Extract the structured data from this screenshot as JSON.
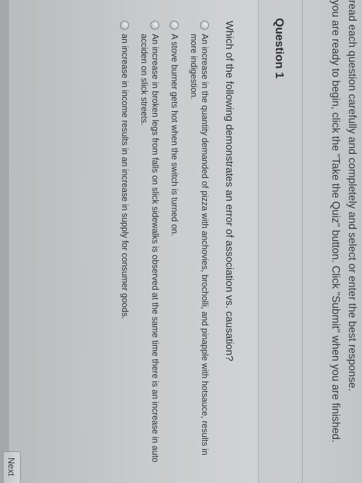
{
  "instructions": {
    "line1": "read each question carefully and completely and select or enter the best response.",
    "line2": "you are ready to begin, click the \"Take the Quiz\" button. Click \"Submit\" when you are finished."
  },
  "question": {
    "title": "Question 1",
    "text": "Which of the following demonstrates an error of association vs. causation?",
    "options": [
      {
        "label": "An increase in the quantity demanded of pizza with anchovies, brocholli, and pinapple with hotsauce, results in more indigestion."
      },
      {
        "label": "A stove burner gets hot when the switch is turned on."
      },
      {
        "label": "An increase in broken legs from falls on slick sidewalks is observed at the same time there is an increase in auto acciden on slick streets."
      },
      {
        "label": "an increase in income results in an increase in supply for consumer goods."
      }
    ]
  },
  "navigation": {
    "next_label": "Next"
  }
}
